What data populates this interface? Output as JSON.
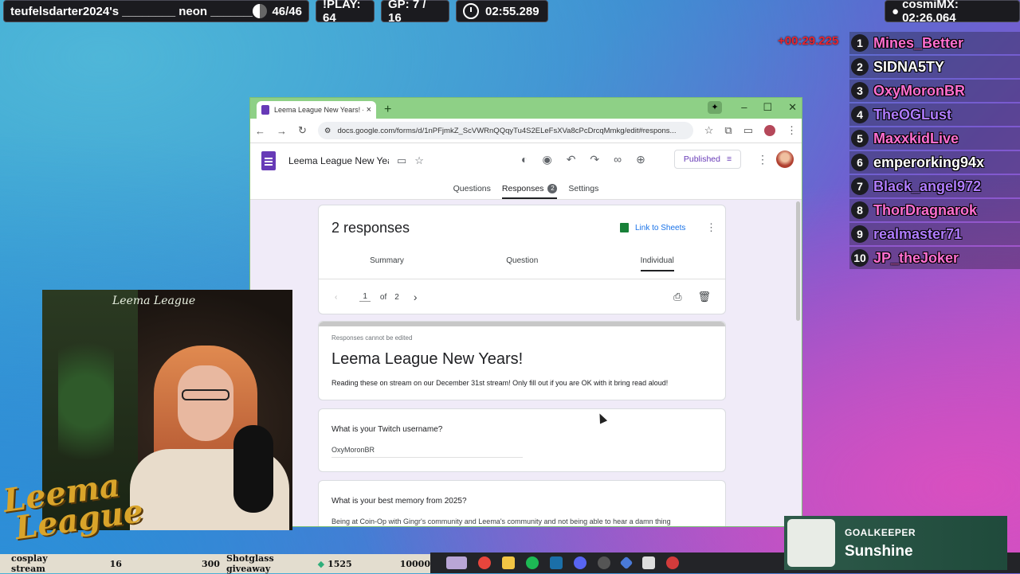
{
  "overlay": {
    "runner": "teufelsdarter2024's ________ neon ________",
    "counter": "46/46",
    "play": "!PLAY: 64",
    "gp": "GP: 7 / 16",
    "timer": "02:55.289",
    "cosmi": "cosmiMX: 02:26.064",
    "delta": "+00:29.225",
    "leaderboard": [
      {
        "rank": "1",
        "name": "Mines_Better",
        "color": "#ff6fd0"
      },
      {
        "rank": "2",
        "name": "SIDNA5TY",
        "color": "#ffffff"
      },
      {
        "rank": "3",
        "name": "OxyMoronBR",
        "color": "#ff6fd0"
      },
      {
        "rank": "4",
        "name": "TheOGLust",
        "color": "#b07cff"
      },
      {
        "rank": "5",
        "name": "MaxxkidLive",
        "color": "#ff6fd0"
      },
      {
        "rank": "6",
        "name": "emperorking94x",
        "color": "#ffffff"
      },
      {
        "rank": "7",
        "name": "Black_angel972",
        "color": "#b07cff"
      },
      {
        "rank": "8",
        "name": "ThorDragnarok",
        "color": "#ff6fd0"
      },
      {
        "rank": "9",
        "name": "realmaster71",
        "color": "#b07cff"
      },
      {
        "rank": "10",
        "name": "JP_theJoker",
        "color": "#ff6fd0"
      }
    ]
  },
  "browser": {
    "tab_title": "Leema League New Years! - Go",
    "tab_close": "×",
    "new_tab": "+",
    "url": "docs.google.com/forms/d/1nPFjmkZ_ScVWRnQQqyTu4S2ELeFsXVa8cPcDrcqMmkg/edit#respons...",
    "win_min": "–",
    "win_max": "☐",
    "win_close": "✕"
  },
  "form": {
    "title": "Leema League New Years!",
    "publish_label": "Published",
    "tabs": {
      "questions": "Questions",
      "responses": "Responses",
      "responses_badge": "2",
      "settings": "Settings"
    },
    "responses": {
      "count_label": "2 responses",
      "link_sheets": "Link to Sheets",
      "summary": "Summary",
      "question": "Question",
      "individual": "Individual",
      "page_current": "1",
      "page_of": "of",
      "page_total": "2"
    },
    "header_card": {
      "note": "Responses cannot be edited",
      "title": "Leema League New Years!",
      "description": "Reading these on stream on our December 31st stream! Only fill out if you are OK with it bring read aloud!"
    },
    "q1": {
      "title": "What is your Twitch username?",
      "answer": "OxyMoronBR"
    },
    "q2": {
      "title": "What is your best memory from 2025?",
      "answer": "Being at Coin-Op with Gingr's community and Leema's community and not being able to hear a damn thing"
    }
  },
  "stream": {
    "cam_label": "Leema League",
    "logo_line1": "Leema",
    "logo_line2": "League",
    "ticker": {
      "t1": "cosplay stream",
      "t2": "16",
      "t3": "300",
      "t4": "Shotglass giveaway",
      "t5": "1525",
      "t6": "10000"
    },
    "goalkeeper_label": "GOALKEEPER",
    "goalkeeper_name": "Sunshine"
  }
}
